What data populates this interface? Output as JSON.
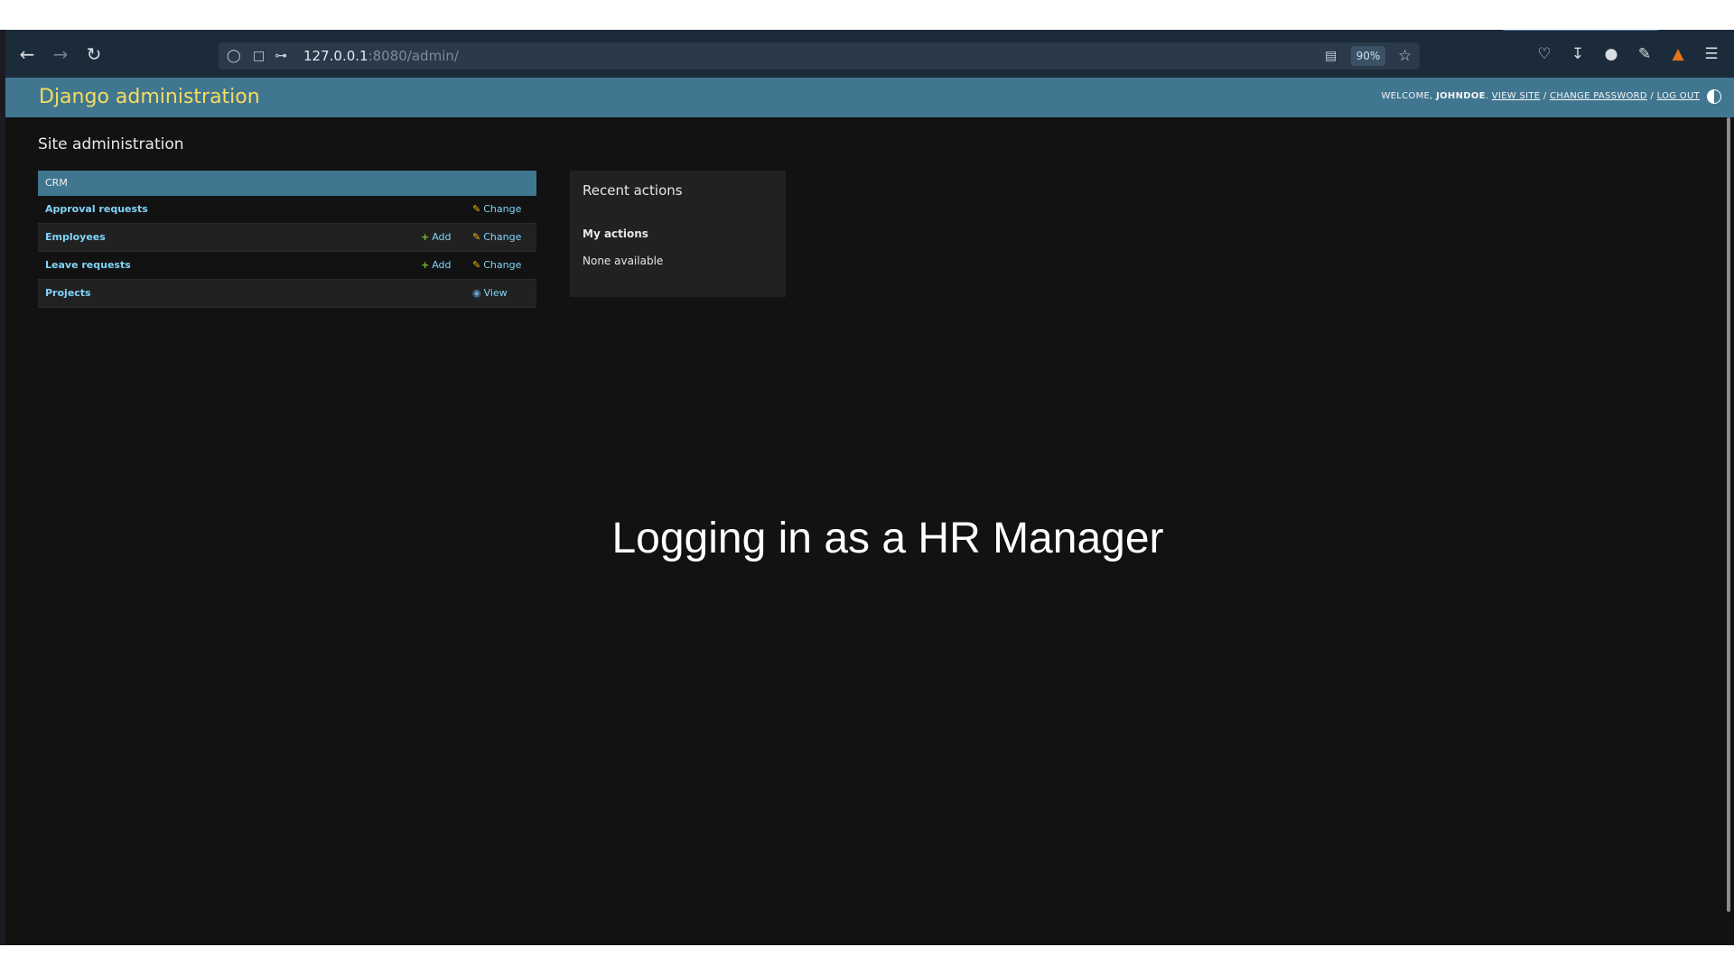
{
  "browser": {
    "url_host": "127.0.0.1",
    "url_path": ":8080/admin/",
    "zoom": "90%"
  },
  "header": {
    "brand": "Django administration",
    "welcome": "WELCOME,",
    "username": "JOHNDOE",
    "view_site": "VIEW SITE",
    "change_password": "CHANGE PASSWORD",
    "log_out": "LOG OUT",
    "separator": " / "
  },
  "page": {
    "title": "Site administration"
  },
  "app_module": {
    "caption": "CRM",
    "models": [
      {
        "name": "Approval requests",
        "add": "",
        "change": "Change",
        "view": ""
      },
      {
        "name": "Employees",
        "add": "Add",
        "change": "Change",
        "view": ""
      },
      {
        "name": "Leave requests",
        "add": "Add",
        "change": "Change",
        "view": ""
      },
      {
        "name": "Projects",
        "add": "",
        "change": "",
        "view": "View"
      }
    ]
  },
  "recent_actions": {
    "title": "Recent actions",
    "subtitle": "My actions",
    "empty_text": "None available"
  },
  "overlay": {
    "caption": "Logging in as a HR Manager"
  },
  "colors": {
    "header_bg": "#417690",
    "brand": "#f5dd5d",
    "link": "#81d4fa",
    "add_icon": "#70bf2b",
    "change_icon": "#efb80b"
  }
}
